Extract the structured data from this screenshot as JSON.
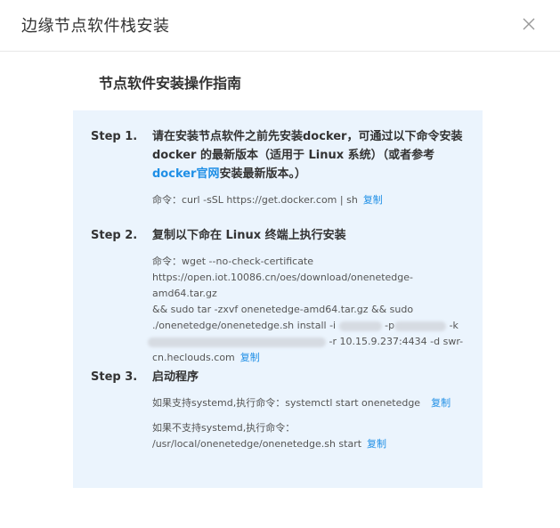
{
  "dialog": {
    "title": "边缘节点软件栈安装",
    "close_icon": "close-icon"
  },
  "guide": {
    "title": "节点软件安装操作指南"
  },
  "step1": {
    "label": "Step 1.",
    "text_a": "请在安装节点软件之前先安装docker，可通过以下命令安装 docker 的最新版本（适用于 Linux 系统）（或者参考",
    "link": "docker官网",
    "text_b": "安装最新版本。）",
    "cmd": "命令：curl -sSL https://get.docker.com | sh",
    "copy": "复制"
  },
  "step2": {
    "label": "Step 2.",
    "title": "复制以下命在 Linux 终端上执行安装",
    "cmd_line1": "命令：wget --no-check-certificate",
    "cmd_line2": "https://open.iot.10086.cn/oes/download/onenetedge-amd64.tar.gz",
    "cmd_line3": "&& sudo tar -zxvf onenetedge-amd64.tar.gz && sudo",
    "cmd_line4a": "./onenetedge/onenetedge.sh install -i",
    "cmd_line4b": "-p",
    "cmd_line4c": "-k",
    "cmd_line5b": "-r 10.15.9.237:4434 -d swr-",
    "cmd_line6": "cn.heclouds.com",
    "copy": "复制"
  },
  "step3": {
    "label": "Step 3.",
    "title": "启动程序",
    "systemd_cmd": "如果支持systemd,执行命令：systemctl start onenetedge",
    "copy1": "复制",
    "nosystemd_line1": "如果不支持systemd,执行命令：",
    "nosystemd_line2": "/usr/local/onenetedge/onenetedge.sh start",
    "copy2": "复制"
  },
  "colors": {
    "accent": "#1f8fe6",
    "panel_bg": "#ebf4fd"
  }
}
